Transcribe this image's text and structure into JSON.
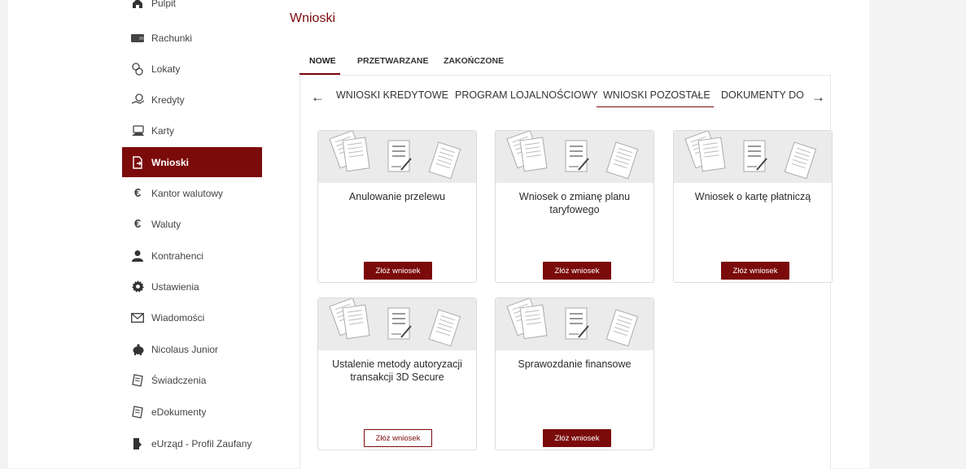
{
  "page": {
    "title": "Wnioski"
  },
  "sidebar": {
    "items": [
      {
        "label": "Pulpit",
        "icon": "home-icon"
      },
      {
        "label": "Rachunki",
        "icon": "wallet-icon"
      },
      {
        "label": "Lokaty",
        "icon": "coins-icon"
      },
      {
        "label": "Kredyty",
        "icon": "hand-coins-icon"
      },
      {
        "label": "Karty",
        "icon": "card-hand-icon"
      },
      {
        "label": "Wnioski",
        "icon": "document-arrow-icon",
        "active": true
      },
      {
        "label": "Kantor walutowy",
        "icon": "euro-icon"
      },
      {
        "label": "Waluty",
        "icon": "euro-icon"
      },
      {
        "label": "Kontrahenci",
        "icon": "person-icon"
      },
      {
        "label": "Ustawienia",
        "icon": "gear-icon"
      },
      {
        "label": "Wiadomości",
        "icon": "envelope-icon"
      },
      {
        "label": "Nicolaus Junior",
        "icon": "piggy-bank-icon"
      },
      {
        "label": "Świadczenia",
        "icon": "document-icon"
      },
      {
        "label": "eDokumenty",
        "icon": "document-icon"
      },
      {
        "label": "eUrząd - Profil Zaufany",
        "icon": "government-icon"
      }
    ]
  },
  "main_tabs": [
    {
      "label": "NOWE",
      "active": true
    },
    {
      "label": "PRZETWARZANE"
    },
    {
      "label": "ZAKOŃCZONE"
    }
  ],
  "sub_tabs": [
    {
      "label": "WNIOSKI KREDYTOWE"
    },
    {
      "label": "PROGRAM LOJALNOŚCIOWY"
    },
    {
      "label": "WNIOSKI POZOSTAŁE",
      "active": true
    },
    {
      "label": "DOKUMENTY DO POBRANIA"
    }
  ],
  "cards": [
    {
      "title": "Anulowanie przelewu",
      "button": "Złóż wniosek",
      "button_style": "filled"
    },
    {
      "title": "Wniosek o zmianę planu taryfowego",
      "button": "Złóż wniosek",
      "button_style": "filled"
    },
    {
      "title": "Wniosek o kartę płatniczą",
      "button": "Złóż wniosek",
      "button_style": "filled"
    },
    {
      "title": "Ustalenie metody autoryzacji transakcji 3D Secure",
      "button": "Złóż wniosek",
      "button_style": "outline"
    },
    {
      "title": "Sprawozdanie finansowe",
      "button": "Złóż wniosek",
      "button_style": "filled"
    }
  ],
  "colors": {
    "accent": "#7b0a0a",
    "background": "#f3f3f4",
    "card_banner": "#ebebeb"
  }
}
